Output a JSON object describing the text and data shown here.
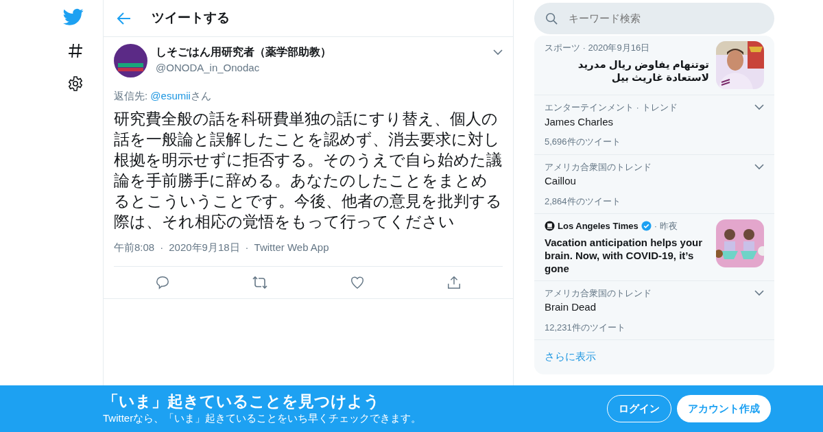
{
  "header": {
    "title": "ツイートする"
  },
  "tweet": {
    "display_name": "しそごはん用研究者（薬学部助教）",
    "handle": "@ONODA_in_Onodac",
    "reply_prefix": "返信先: ",
    "reply_to": "@esumii",
    "reply_suffix": "さん",
    "text": "研究費全般の話を科研費単独の話にすり替え、個人の話を一般論と誤解したことを認めず、消去要求に対し根拠を明示せずに拒否する。そのうえで自ら始めた議論を手前勝手に辞める。あなたのしたことをまとめるとこういうことです。今後、他者の意見を批判する際は、それ相応の覚悟をもって行ってください",
    "meta": [
      "午前8:08",
      "2020年9月18日",
      "Twitter Web App"
    ],
    "meta_separator": "·"
  },
  "search": {
    "placeholder": "キーワード検索"
  },
  "trends": [
    {
      "kind": "news",
      "context": "スポーツ · 2020年9月16日",
      "headline": "توتنهام يفاوض ريال مدريد لاستعادة غاريث بيل"
    },
    {
      "kind": "trend",
      "context": "エンターテインメント · トレンド",
      "name": "James Charles",
      "count": "5,696件のツイート"
    },
    {
      "kind": "trend",
      "context": "アメリカ合衆国のトレンド",
      "name": "Caillou",
      "count": "2,864件のツイート"
    },
    {
      "kind": "news",
      "source": "Los Angeles Times",
      "verified": true,
      "separator": "·",
      "time": "昨夜",
      "headline": "Vacation anticipation helps your brain. Now, with COVID-19, it’s gone"
    },
    {
      "kind": "trend",
      "context": "アメリカ合衆国のトレンド",
      "name": "Brain Dead",
      "count": "12,231件のツイート"
    }
  ],
  "show_more": "さらに表示",
  "banner": {
    "title": "「いま」起きていることを見つけよう",
    "subtitle": "Twitterなら、「いま」起きていることをいち早くチェックできます。",
    "login": "ログイン",
    "signup": "アカウント作成"
  }
}
